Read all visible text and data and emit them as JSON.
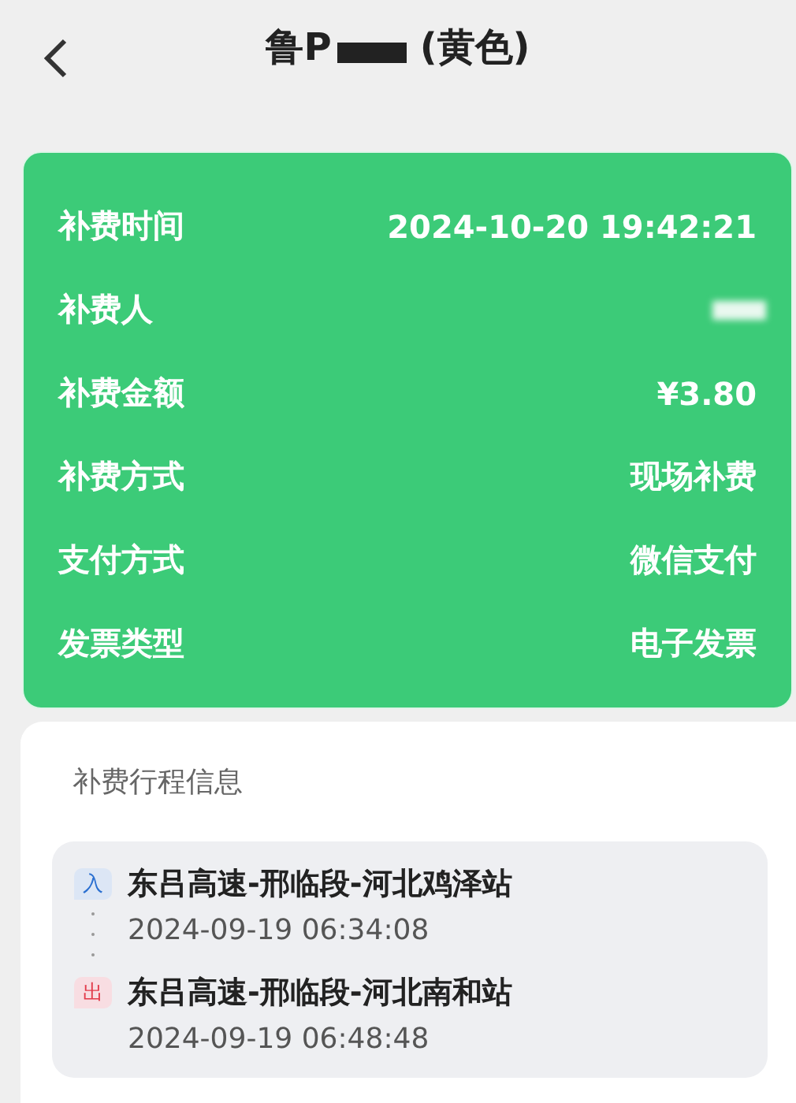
{
  "header": {
    "title_start": "鲁P",
    "title_end": "(黄色)",
    "redacted": true
  },
  "details": [
    {
      "label": "补费时间",
      "value": "2024-10-20 19:42:21"
    },
    {
      "label": "补费人",
      "redacted": true
    },
    {
      "label": "补费金额",
      "value": "¥3.80"
    },
    {
      "label": "补费方式",
      "value": "现场补费"
    },
    {
      "label": "支付方式",
      "value": "微信支付"
    },
    {
      "label": "发票类型",
      "value": "电子发票"
    }
  ],
  "trip": {
    "title": "补费行程信息",
    "stops": [
      {
        "kind": "entry",
        "badge": "入",
        "station": "东吕高速-邢临段-河北鸡泽站",
        "time": "2024-09-19 06:34:08"
      },
      {
        "kind": "exit",
        "badge": "出",
        "station": "东吕高速-邢临段-河北南和站",
        "time": "2024-09-19 06:48:48"
      }
    ]
  }
}
